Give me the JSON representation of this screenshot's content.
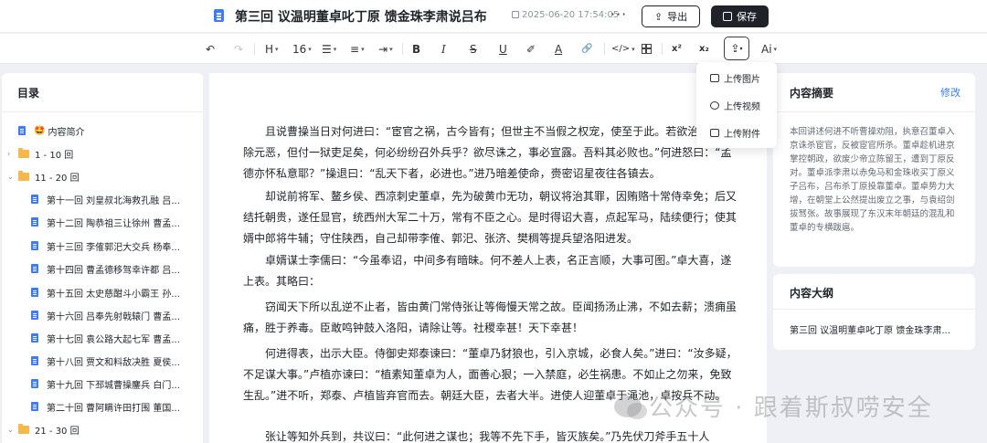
{
  "header": {
    "title": "第三回 议温明董卓叱丁原 馈金珠李肃说吕布",
    "save_time": "2025-06-20 17:54:05",
    "more_label": "···",
    "export_label": "导出",
    "save_label": "保存"
  },
  "toolbar": {
    "undo": "↶",
    "redo": "↷",
    "heading": "H",
    "font_size": "16",
    "list": "☰",
    "align": "≡",
    "indent": "⇥",
    "bold": "B",
    "italic": "I",
    "strike": "S",
    "underline": "U",
    "highlight": "✐",
    "font_color": "A",
    "link": "🔗",
    "code": "</>",
    "superscript": "x²",
    "subscript": "x₂",
    "upload": "⇪",
    "ai": "Ai"
  },
  "upload_menu": {
    "items": [
      {
        "label": "上传图片",
        "icon": "image-icon"
      },
      {
        "label": "上传视频",
        "icon": "video-icon"
      },
      {
        "label": "上传附件",
        "icon": "attachment-icon"
      }
    ]
  },
  "sidebar": {
    "title": "目录",
    "items": [
      {
        "label": "内容简介",
        "emoji": "🤩",
        "kind": "doc"
      },
      {
        "label": "1 - 10 回",
        "kind": "folder-collapsed"
      },
      {
        "label": "11 - 20 回",
        "kind": "folder-expanded"
      },
      {
        "label": "第十一回 刘皇叔北海救孔融 吕...",
        "kind": "child"
      },
      {
        "label": "第十二回 陶恭祖三让徐州 曹孟...",
        "kind": "child"
      },
      {
        "label": "第十三回 李傕郭汜大交兵 杨奉...",
        "kind": "child"
      },
      {
        "label": "第十四回 曹孟德移驾幸许都 吕...",
        "kind": "child"
      },
      {
        "label": "第十五回 太史慈酣斗小霸王 孙...",
        "kind": "child"
      },
      {
        "label": "第十六回 吕奉先射戟辕门 曹孟...",
        "kind": "child"
      },
      {
        "label": "第十七回 袁公路大起七军 曹孟...",
        "kind": "child"
      },
      {
        "label": "第十八回 贾文和料敌决胜 夏侯...",
        "kind": "child"
      },
      {
        "label": "第十九回 下邳城曹操鏖兵 白门...",
        "kind": "child"
      },
      {
        "label": "第二十回 曹阿瞒许田打围 董国...",
        "kind": "child"
      },
      {
        "label": "21 - 30 回",
        "kind": "folder-expanded"
      }
    ]
  },
  "editor": {
    "paragraphs": [
      "且说曹操当日对何进曰：“宦官之祸，古今皆有；但世主不当假之权宠，使至于此。若欲治罪，当除元恶，但付一狱吏足矣，何必纷纷召外兵乎？欲尽诛之，事必宣露。吾料其必败也。”何进怒曰：“孟德亦怀私意耶？”操退曰：“乱天下者，必进也。”进乃暗差使命，赍密诏星夜往各镇去。",
      "却说前将军、鳌乡侯、西凉刺史董卓，先为破黄巾无功，朝议将治其罪，因贿赂十常侍幸免；后又结托朝贵，遂任显官，统西州大军二十万，常有不臣之心。是时得诏大喜，点起军马，陆续便行；使其婿中郎将牛辅；守住陕西，自己却带李傕、郭汜、张济、樊稠等提兵望洛阳进发。",
      "卓婿谋士李儒曰：“今虽奉诏，中间多有暗昧。何不差人上表，名正言顺，大事可图。”卓大喜，遂上表。其略曰：",
      "窃闻天下所以乱逆不止者，皆由黄门常侍张让等侮慢天常之故。臣闻扬汤止沸，不如去薪；溃痈虽痛，胜于养毒。臣敢鸣钟鼓入洛阳，请除让等。社稷幸甚！天下幸甚！",
      "何进得表，出示大臣。侍御史郑泰谏曰：“董卓乃豺狼也，引入京城，必食人矣。”进曰：“汝多疑，不足谋大事。”卢植亦谏曰：“植素知董卓为人，面善心狠；一入禁庭，必生祸患。不如止之勿来，免致生乱。”进不听，郑泰、卢植皆弃官而去。朝廷大臣，去者大半。进使人迎董卓于渑池，卓按兵不动。",
      "张让等知外兵到，共议曰：“此何进之谋也；我等不先下手，皆灭族矣。”乃先伏刀斧手五十人"
    ]
  },
  "summary": {
    "title": "内容摘要",
    "edit_label": "修改",
    "text": "本回讲述何进不听曹操劝阻，执意召董卓入京诛杀宦官，反被宦官所杀。董卓趁机进京掌控朝政，欲废少帝立陈留王，遭到丁原反对。董卓派李肃以赤兔马和金珠收买丁原义子吕布，吕布杀丁原投靠董卓。董卓势力大增，在朝堂上公然提出废立之事，与袁绍剑拔驽张。故事展现了东汉末年朝廷的混乱和董卓的专横跋扈。"
  },
  "outline": {
    "title": "内容大纲",
    "items": [
      "第三回 议温明董卓叱丁原 馈金珠李肃..."
    ]
  },
  "watermark": {
    "text": "公众号 · 跟着斯叔唠安全"
  },
  "colors": {
    "accent": "#3d7bf7",
    "folder": "#f5b84a",
    "primary_button": "#1f2329"
  }
}
